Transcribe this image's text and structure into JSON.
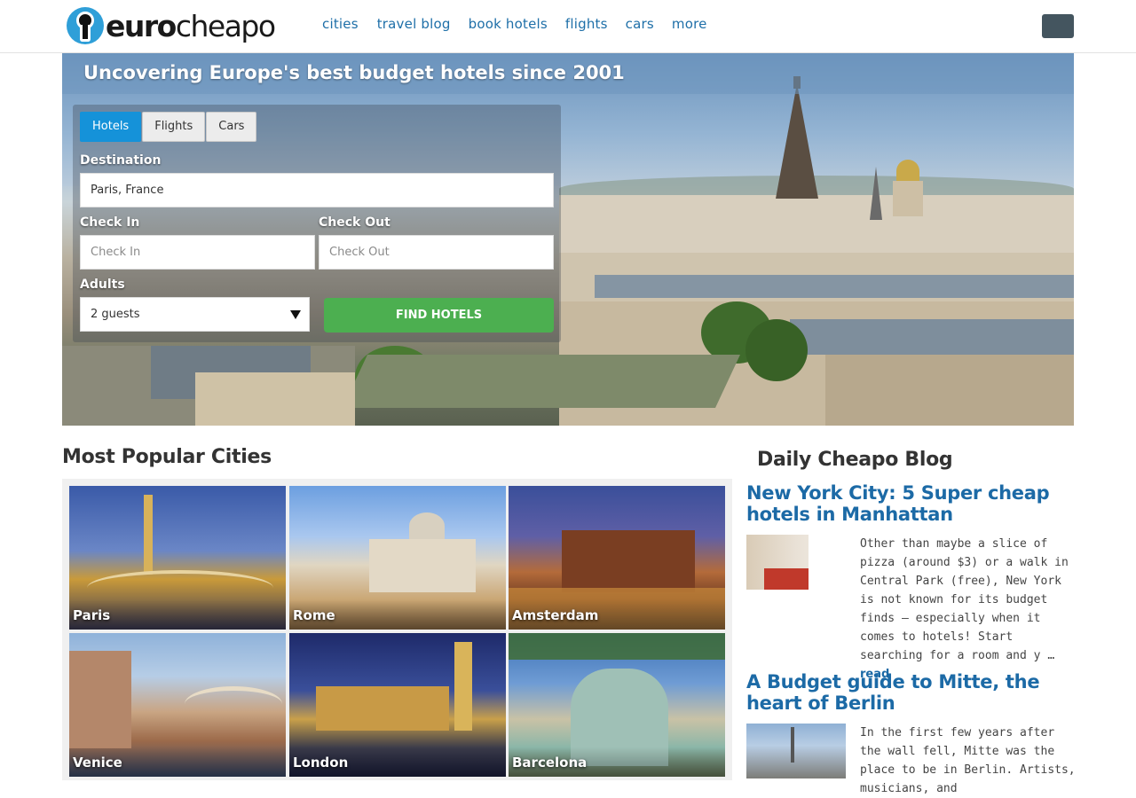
{
  "header": {
    "logo_text_bold": "euro",
    "logo_text_light": "cheapo",
    "nav": [
      "cities",
      "travel blog",
      "book hotels",
      "flights",
      "cars",
      "more"
    ]
  },
  "hero": {
    "title": "Uncovering Europe's best budget hotels since 2001",
    "tabs": [
      "Hotels",
      "Flights",
      "Cars"
    ],
    "active_tab": "Hotels",
    "destination_label": "Destination",
    "destination_value": "Paris, France",
    "checkin_label": "Check In",
    "checkin_placeholder": "Check In",
    "checkout_label": "Check Out",
    "checkout_placeholder": "Check Out",
    "adults_label": "Adults",
    "adults_value": "2 guests",
    "find_button": "FIND HOTELS"
  },
  "popular": {
    "title": "Most Popular Cities",
    "cities": [
      "Paris",
      "Rome",
      "Amsterdam",
      "Venice",
      "London",
      "Barcelona"
    ]
  },
  "blog": {
    "title": "Daily Cheapo Blog",
    "posts": [
      {
        "title": "New York City: 5 Super cheap hotels in Manhattan",
        "excerpt": "Other than maybe a slice of pizza (around $3) or a walk in Central Park (free), New York is not known for its budget finds — especially when it comes to hotels! Start searching for a room and y …",
        "read_more": "read"
      },
      {
        "title": "A Budget guide to Mitte, the heart of Berlin",
        "excerpt": "In the first few years after the wall fell, Mitte was the place to be in Berlin. Artists, musicians, and"
      }
    ]
  },
  "colors": {
    "link": "#1c6aa6",
    "tab_active": "#1592d9",
    "find_button": "#4caf50",
    "menu_button": "#44555f"
  }
}
